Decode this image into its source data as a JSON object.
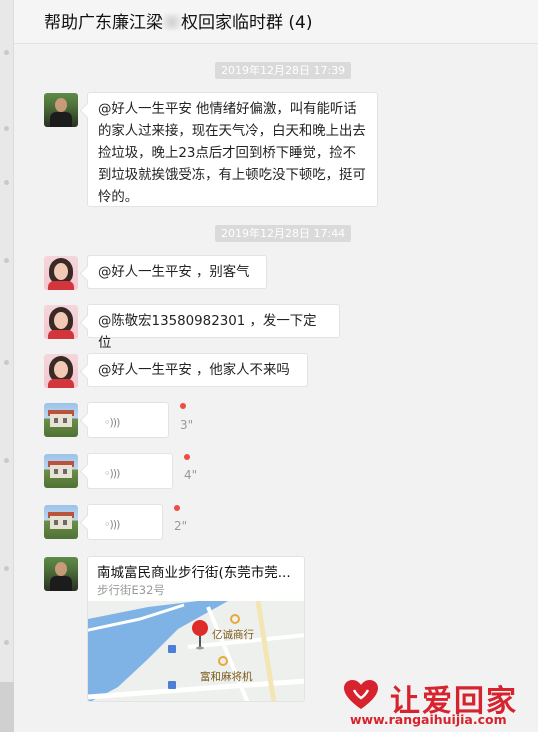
{
  "window": {
    "title_prefix": "帮助广东廉江梁",
    "title_suffix": "权回家临时群 (4)"
  },
  "timestamps": [
    "2019年12月28日 17:39",
    "2019年12月28日 17:44"
  ],
  "messages": [
    {
      "sender": "man",
      "text": "@好人一生平安 他情绪好偏激，叫有能听话的家人过来接，现在天气冷，白天和晚上出去捡垃圾，晚上23点后才回到桥下睡觉，捡不到垃圾就挨饿受冻，有上顿吃没下顿吃，挺可怜的。"
    },
    {
      "sender": "woman",
      "text": "@好人一生平安 ，别客气"
    },
    {
      "sender": "woman",
      "text": "@陈敬宏13580982301 ，发一下定位"
    },
    {
      "sender": "woman",
      "text": "@好人一生平安 ，他家人不来吗"
    }
  ],
  "voice_messages": [
    {
      "sender": "house",
      "duration": "3\"",
      "unread": true
    },
    {
      "sender": "house",
      "duration": "4\"",
      "unread": true
    },
    {
      "sender": "house",
      "duration": "2\"",
      "unread": true
    }
  ],
  "location": {
    "sender": "man",
    "name": "南城富民商业步行街(东莞市莞...",
    "address": "步行街E32号",
    "poi_1": "亿诚商行",
    "poi_2": "富和麻将机"
  },
  "watermark": {
    "text": "让爱回家",
    "url": "www.rangaihuijia.com",
    "color": "#d7232e"
  }
}
